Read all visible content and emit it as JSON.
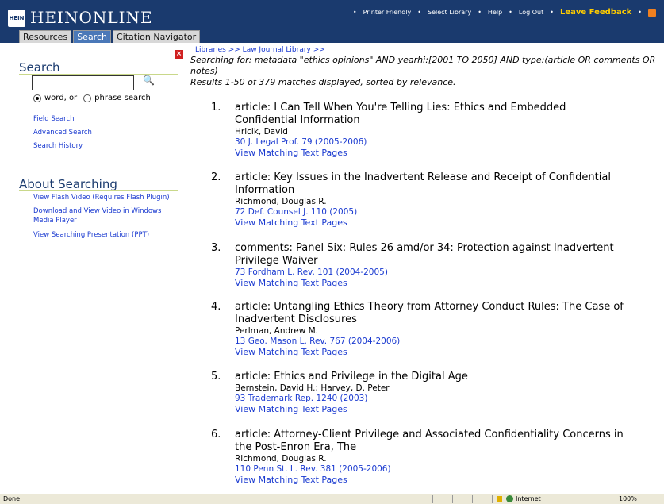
{
  "header": {
    "logo_text": "HEINONLINE",
    "logo_mark": "HEIN",
    "links": [
      "Printer Friendly",
      "Select Library",
      "Help",
      "Log Out"
    ],
    "feedback": "Leave Feedback",
    "tabs": [
      {
        "label": "Resources",
        "active": false
      },
      {
        "label": "Search",
        "active": true
      },
      {
        "label": "Citation Navigator",
        "active": false
      }
    ]
  },
  "sidebar": {
    "search_title": "Search",
    "search_value": "",
    "radio_word": "word, or",
    "radio_phrase": "phrase search",
    "links": [
      "Field Search",
      "Advanced Search",
      "Search History"
    ],
    "about_title": "About Searching",
    "about_links": [
      "View Flash Video (Requires Flash Plugin)",
      "Download and View Video in Windows Media Player",
      "View Searching Presentation (PPT)"
    ]
  },
  "main": {
    "breadcrumb": "Libraries >> Law Journal Library >>",
    "query": "Searching for: metadata \"ethics opinions\" AND yearhi:[2001 TO 2050] AND type:(article OR comments OR notes)",
    "summary": "Results 1-50 of 379 matches displayed, sorted by relevance.",
    "results": [
      {
        "num": "1.",
        "title": "article: I Can Tell When You're Telling Lies: Ethics and Embedded Confidential Information",
        "author": "Hricik, David",
        "cite": "30 J. Legal Prof. 79 (2005-2006)",
        "view": "View Matching Text Pages"
      },
      {
        "num": "2.",
        "title": "article: Key Issues in the Inadvertent Release and Receipt of Confidential Information",
        "author": "Richmond, Douglas R.",
        "cite": "72 Def. Counsel J. 110 (2005)",
        "view": "View Matching Text Pages"
      },
      {
        "num": "3.",
        "title": "comments: Panel Six: Rules 26 amd/or 34: Protection against Inadvertent Privilege Waiver",
        "author": "",
        "cite": "73 Fordham L. Rev. 101 (2004-2005)",
        "view": "View Matching Text Pages"
      },
      {
        "num": "4.",
        "title": "article: Untangling Ethics Theory from Attorney Conduct Rules: The Case of Inadvertent Disclosures",
        "author": "Perlman, Andrew M.",
        "cite": "13 Geo. Mason L. Rev. 767 (2004-2006)",
        "view": "View Matching Text Pages"
      },
      {
        "num": "5.",
        "title": "article: Ethics and Privilege in the Digital Age",
        "author": "Bernstein, David H.; Harvey, D. Peter",
        "cite": "93 Trademark Rep. 1240 (2003)",
        "view": "View Matching Text Pages"
      },
      {
        "num": "6.",
        "title": "article: Attorney-Client Privilege and Associated Confidentiality Concerns in the Post-Enron Era, The",
        "author": "Richmond, Douglas R.",
        "cite": "110 Penn St. L. Rev. 381 (2005-2006)",
        "view": "View Matching Text Pages"
      }
    ]
  },
  "status": {
    "left": "Done",
    "zone": "Internet",
    "zoom": "100%"
  }
}
